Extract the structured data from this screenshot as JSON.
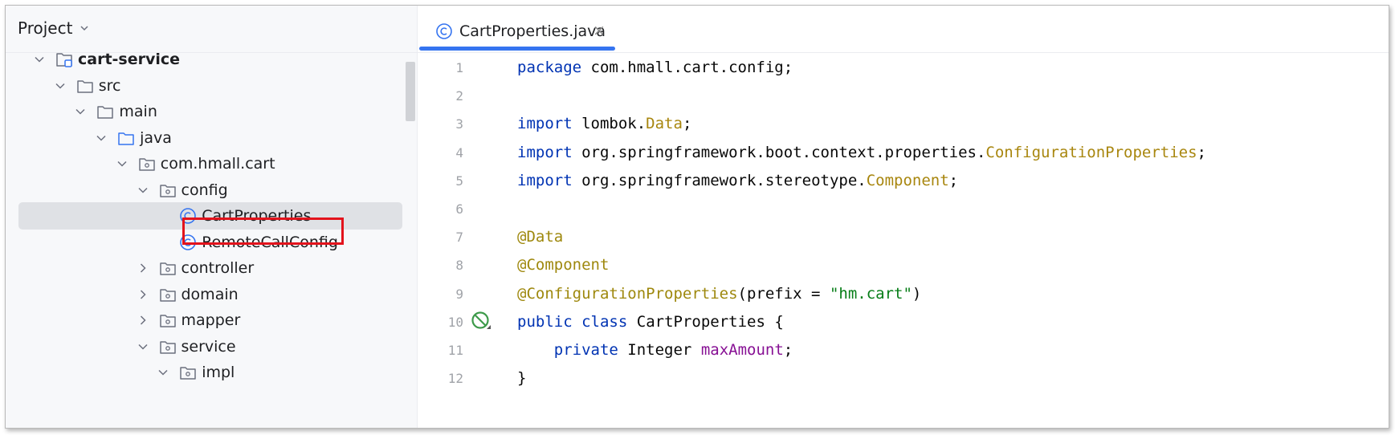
{
  "project_panel": {
    "title": "Project",
    "tree": [
      {
        "label": "cart-service",
        "depth": 0,
        "expanded": true,
        "icon": "module-folder-icon",
        "bold": true
      },
      {
        "label": "src",
        "depth": 1,
        "expanded": true,
        "icon": "folder-icon"
      },
      {
        "label": "main",
        "depth": 2,
        "expanded": true,
        "icon": "folder-icon"
      },
      {
        "label": "java",
        "depth": 3,
        "expanded": true,
        "icon": "source-folder-icon"
      },
      {
        "label": "com.hmall.cart",
        "depth": 4,
        "expanded": true,
        "icon": "package-icon"
      },
      {
        "label": "config",
        "depth": 5,
        "expanded": true,
        "icon": "package-icon"
      },
      {
        "label": "CartProperties",
        "depth": 6,
        "expanded": null,
        "icon": "java-class-icon",
        "selected": true
      },
      {
        "label": "RemoteCallConfig",
        "depth": 6,
        "expanded": null,
        "icon": "java-class-icon"
      },
      {
        "label": "controller",
        "depth": 5,
        "expanded": false,
        "icon": "package-icon"
      },
      {
        "label": "domain",
        "depth": 5,
        "expanded": false,
        "icon": "package-icon"
      },
      {
        "label": "mapper",
        "depth": 5,
        "expanded": false,
        "icon": "package-icon"
      },
      {
        "label": "service",
        "depth": 5,
        "expanded": true,
        "icon": "package-icon"
      },
      {
        "label": "impl",
        "depth": 6,
        "expanded": true,
        "icon": "package-icon"
      }
    ]
  },
  "editor": {
    "tab_label": "CartProperties.java",
    "tab_close": "×",
    "lines": [
      {
        "n": "1",
        "tokens": [
          [
            "kw",
            "package"
          ],
          [
            "",
            "com.hmall.cart.config;"
          ]
        ]
      },
      {
        "n": "2",
        "tokens": []
      },
      {
        "n": "3",
        "tokens": [
          [
            "kw",
            "import"
          ],
          [
            "",
            "lombok."
          ],
          [
            "cls",
            "Data"
          ],
          [
            "",
            ";"
          ]
        ]
      },
      {
        "n": "4",
        "tokens": [
          [
            "kw",
            "import"
          ],
          [
            "",
            "org.springframework.boot.context.properties."
          ],
          [
            "cls",
            "ConfigurationProperties"
          ],
          [
            "",
            ";"
          ]
        ]
      },
      {
        "n": "5",
        "tokens": [
          [
            "kw",
            "import"
          ],
          [
            "",
            "org.springframework.stereotype."
          ],
          [
            "cls",
            "Component"
          ],
          [
            "",
            ";"
          ]
        ]
      },
      {
        "n": "6",
        "tokens": []
      },
      {
        "n": "7",
        "tokens": [
          [
            "ann",
            "@Data"
          ]
        ]
      },
      {
        "n": "8",
        "tokens": [
          [
            "ann",
            "@Component"
          ]
        ]
      },
      {
        "n": "9",
        "tokens": [
          [
            "ann",
            "@ConfigurationProperties"
          ],
          [
            "",
            "(prefix = "
          ],
          [
            "str",
            "\"hm.cart\""
          ],
          [
            "",
            ")"
          ]
        ]
      },
      {
        "n": "10",
        "tokens": [
          [
            "kw",
            "public"
          ],
          [
            "kw",
            "class"
          ],
          [
            "",
            "CartProperties {"
          ]
        ],
        "gutter_icon": "no-usages-icon"
      },
      {
        "n": "11",
        "tokens": [
          [
            "",
            "    "
          ],
          [
            "kw",
            "private"
          ],
          [
            "",
            "Integer "
          ],
          [
            "fld",
            "maxAmount"
          ],
          [
            "",
            ";"
          ]
        ]
      },
      {
        "n": "12",
        "tokens": [
          [
            "",
            "}"
          ]
        ]
      }
    ]
  },
  "colors": {
    "keyword": "#0033b3",
    "annotation": "#9e880d",
    "class_ref": "#a8860e",
    "string": "#067d17",
    "field": "#871094",
    "accent": "#3574f0",
    "highlight_box": "#e3131c"
  }
}
